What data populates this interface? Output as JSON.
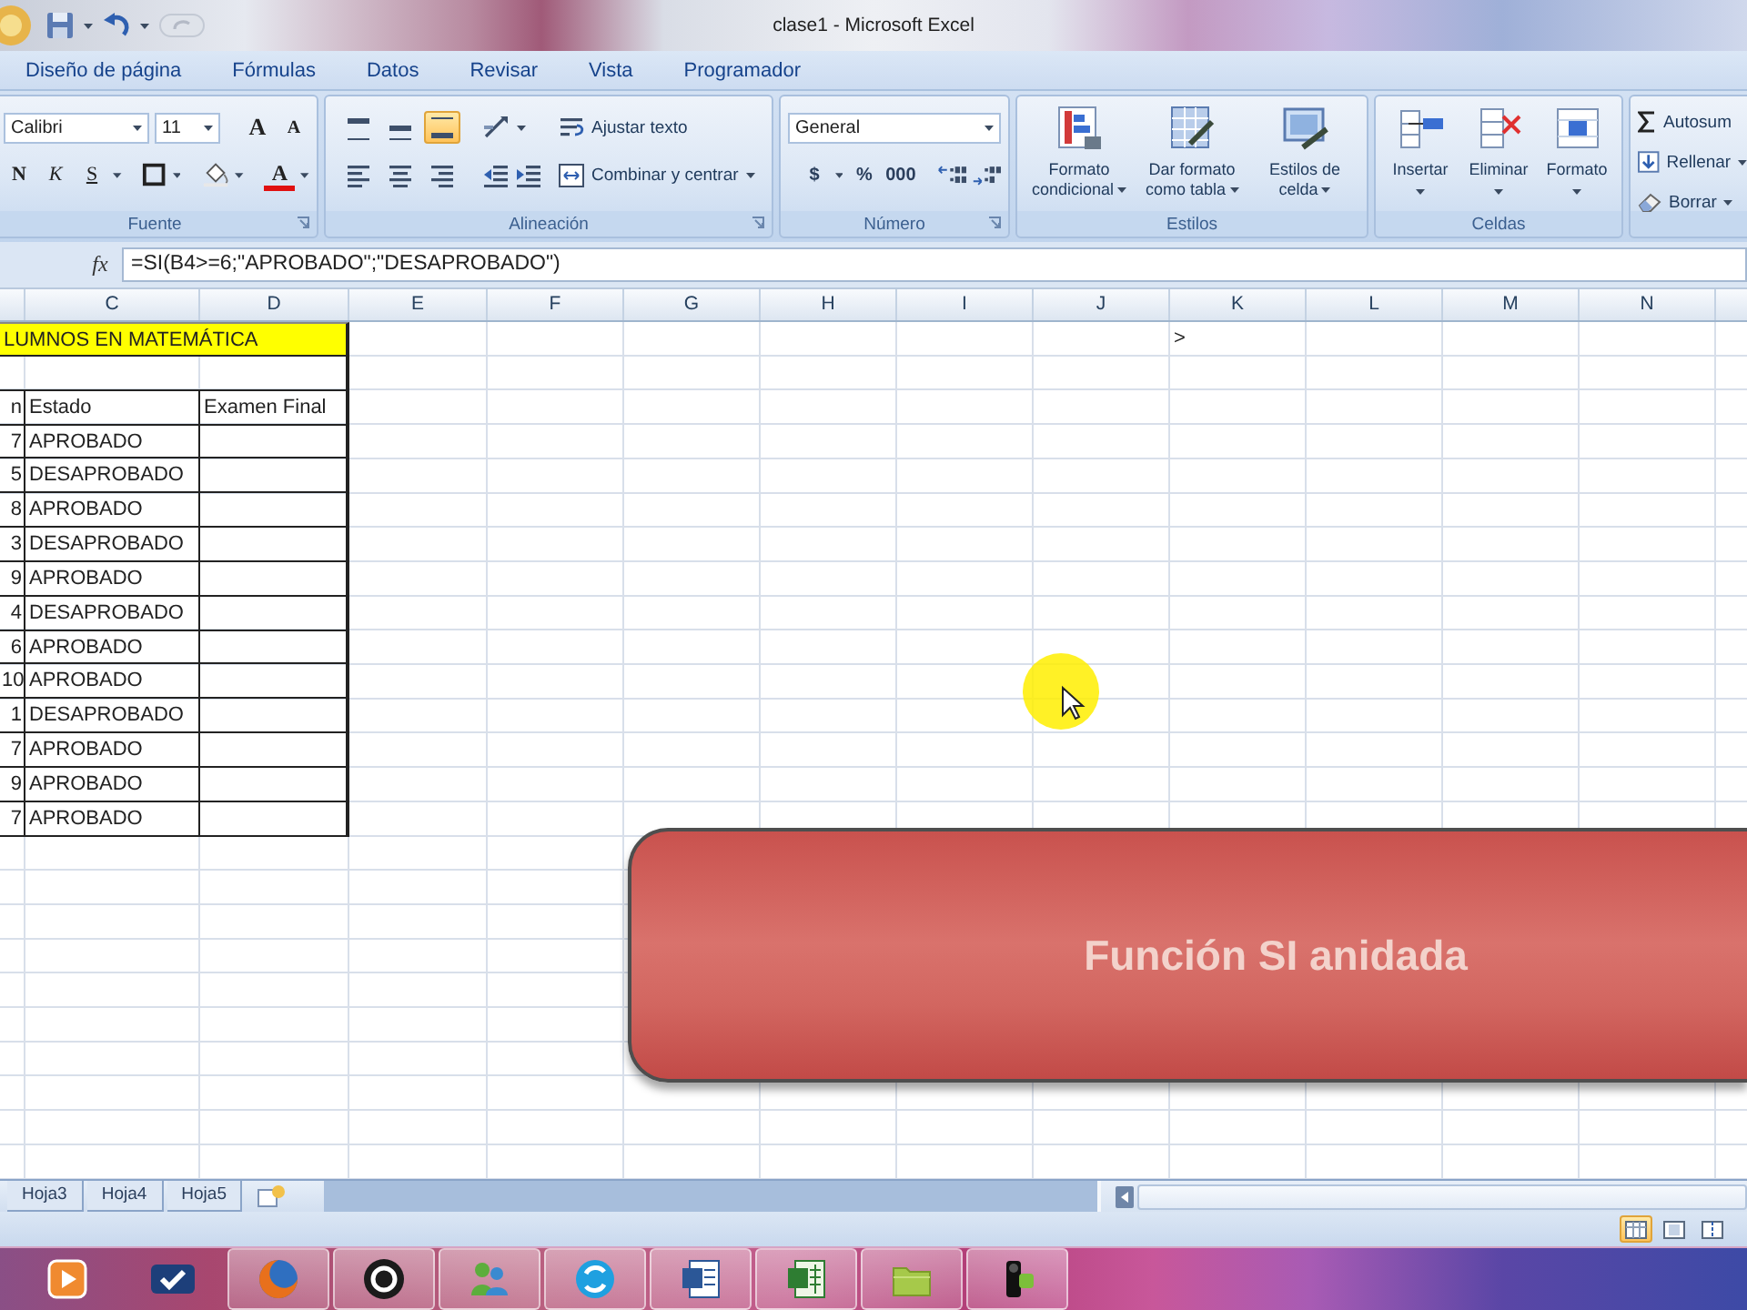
{
  "window": {
    "title": "clase1 - Microsoft Excel"
  },
  "ribbon_tabs": [
    {
      "label": "Diseño de página",
      "selected": false
    },
    {
      "label": "Fórmulas",
      "selected": false
    },
    {
      "label": "Datos",
      "selected": false
    },
    {
      "label": "Revisar",
      "selected": false
    },
    {
      "label": "Vista",
      "selected": false
    },
    {
      "label": "Programador",
      "selected": false
    }
  ],
  "ribbon_groups": [
    {
      "kind": "font",
      "label": "Fuente",
      "font_name": "Calibri",
      "font_size": "11",
      "size_buttons": [
        "A",
        "A"
      ],
      "style_buttons": [
        "N",
        "K",
        "S"
      ],
      "font_color_button": "A"
    },
    {
      "kind": "alignment",
      "label": "Alineación",
      "vertical_align": [
        {
          "selected": false
        },
        {
          "selected": false
        },
        {
          "selected": true
        }
      ],
      "wrap_text": "Ajustar texto",
      "merge": "Combinar y centrar"
    },
    {
      "kind": "number",
      "label": "Número",
      "format": "General",
      "buttons": [
        "$",
        "%",
        "000"
      ]
    },
    {
      "kind": "styles",
      "label": "Estilos",
      "buttons": [
        {
          "lines": [
            "Formato",
            "condicional"
          ]
        },
        {
          "lines": [
            "Dar formato",
            "como tabla"
          ]
        },
        {
          "lines": [
            "Estilos de",
            "celda"
          ]
        }
      ]
    },
    {
      "kind": "cells",
      "label": "Celdas",
      "buttons": [
        "Insertar",
        "Eliminar",
        "Formato"
      ]
    },
    {
      "kind": "editing",
      "buttons": [
        "Autosum",
        "Rellenar",
        "Borrar"
      ]
    }
  ],
  "formula_bar": {
    "fx": "fx",
    "formula": "=SI(B4>=6;\"APROBADO\";\"DESAPROBADO\")"
  },
  "sheet": {
    "columns": [
      "C",
      "D",
      "E",
      "F",
      "G",
      "H",
      "I",
      "J",
      "K",
      "L",
      "M",
      "N"
    ],
    "title": "LUMNOS EN MATEMÁTICA",
    "cell_k1": ">",
    "table_header": {
      "column_1": "n",
      "estado": "Estado",
      "examen_final": "Examen Final"
    },
    "table_rows": [
      {
        "column_1": "7",
        "estado": "APROBADO"
      },
      {
        "column_1": "5",
        "estado": "DESAPROBADO"
      },
      {
        "column_1": "8",
        "estado": "APROBADO"
      },
      {
        "column_1": "3",
        "estado": "DESAPROBADO"
      },
      {
        "column_1": "9",
        "estado": "APROBADO"
      },
      {
        "column_1": "4",
        "estado": "DESAPROBADO"
      },
      {
        "column_1": "6",
        "estado": "APROBADO"
      },
      {
        "column_1": "10",
        "estado": "APROBADO"
      },
      {
        "column_1": "1",
        "estado": "DESAPROBADO"
      },
      {
        "column_1": "7",
        "estado": "APROBADO"
      },
      {
        "column_1": "9",
        "estado": "APROBADO"
      },
      {
        "column_1": "7",
        "estado": "APROBADO"
      }
    ]
  },
  "banner": {
    "text": "Función SI anidada"
  },
  "sheet_tabs": [
    {
      "label": "Hoja3",
      "selected": false
    },
    {
      "label": "Hoja4",
      "selected": false
    },
    {
      "label": "Hoja5",
      "selected": false
    }
  ],
  "status_bar": {
    "view_buttons": [
      {
        "selected": true
      },
      {
        "selected": false
      },
      {
        "selected": false
      }
    ]
  },
  "taskbar": [
    {
      "kind": "player",
      "running": false
    },
    {
      "kind": "tasks",
      "running": false
    },
    {
      "kind": "browser",
      "running": true
    },
    {
      "kind": "ring",
      "running": true
    },
    {
      "kind": "messenger",
      "running": true
    },
    {
      "kind": "call",
      "running": true
    },
    {
      "kind": "document",
      "running": true
    },
    {
      "kind": "spreadsheet",
      "running": true
    },
    {
      "kind": "folder",
      "running": true
    },
    {
      "kind": "camcorder",
      "running": true
    }
  ]
}
